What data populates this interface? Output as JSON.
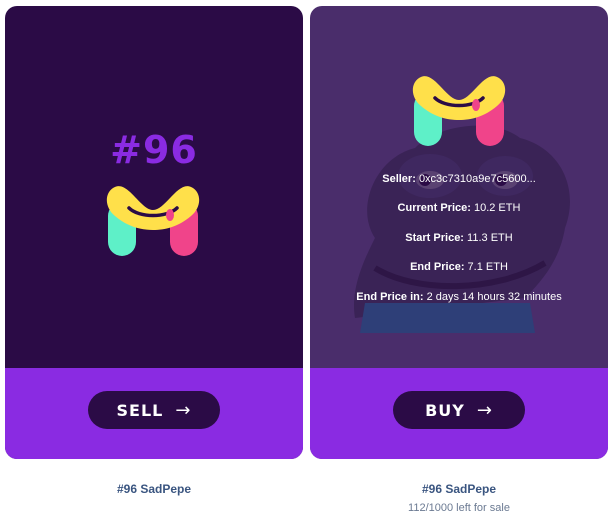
{
  "left_card": {
    "edition_label": "#96",
    "button_label": "SELL",
    "button_arrow": "→",
    "caption_title": "#96 SadPepe"
  },
  "right_card": {
    "seller_label": "Seller:",
    "seller_value": "0xc3c7310a9e7c5600...",
    "current_price_label": "Current Price:",
    "current_price_value": "10.2 ETH",
    "start_price_label": "Start Price:",
    "start_price_value": "11.3 ETH",
    "end_price_label": "End Price:",
    "end_price_value": "7.1 ETH",
    "end_price_in_label": "End Price in:",
    "end_price_in_value": "2 days 14 hours 32 minutes",
    "button_label": "BUY",
    "button_arrow": "→",
    "caption_title": "#96 SadPepe",
    "caption_sub": "112/1000 left for sale"
  },
  "colors": {
    "card_dark": "#2b0b46",
    "card_overlay": "#4a2d6b",
    "accent_purple": "#8a2be2",
    "logo_yellow": "#ffe04a",
    "logo_mint": "#5ef0c8",
    "logo_pink": "#f0448a"
  },
  "icons": {
    "logo": "m-smile-logo-icon",
    "arrow": "arrow-right-icon",
    "artwork": "sad-pepe-artwork"
  }
}
